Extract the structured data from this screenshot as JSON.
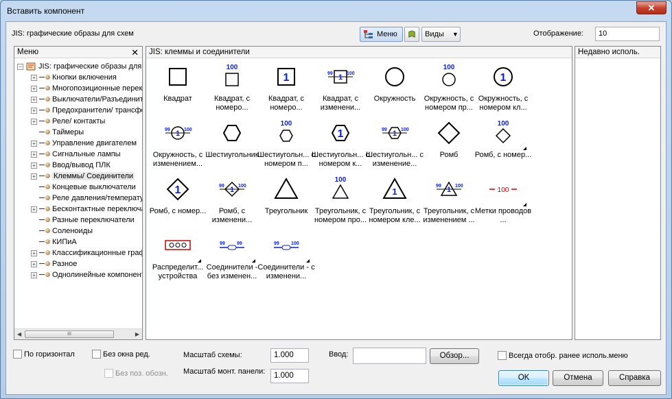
{
  "window": {
    "title": "Вставить компонент"
  },
  "header": {
    "label": "JIS: графические образы для схем",
    "menu_button": "Меню",
    "views_button": "Виды",
    "display_label": "Отображение:",
    "display_value": "10"
  },
  "left_pane": {
    "title": "Меню",
    "root": "JIS: графические образы для схем",
    "items": [
      {
        "label": "Кнопки включения",
        "expandable": true
      },
      {
        "label": "Многопозиционные переключатели",
        "expandable": true
      },
      {
        "label": "Выключатели/Разъединители",
        "expandable": true
      },
      {
        "label": "Предохранители/ трансформаторы",
        "expandable": true
      },
      {
        "label": "Реле/ контакты",
        "expandable": true
      },
      {
        "label": "Таймеры",
        "expandable": false
      },
      {
        "label": "Управление двигателем",
        "expandable": true
      },
      {
        "label": "Сигнальные лампы",
        "expandable": true
      },
      {
        "label": "Ввод/вывод ПЛК",
        "expandable": true
      },
      {
        "label": "Клеммы/ Соединители",
        "expandable": true,
        "selected": true
      },
      {
        "label": "Концевые выключатели",
        "expandable": false
      },
      {
        "label": "Реле давления/температуры",
        "expandable": false
      },
      {
        "label": "Бесконтактные переключатели",
        "expandable": true
      },
      {
        "label": "Разные переключатели",
        "expandable": false
      },
      {
        "label": "Соленоиды",
        "expandable": false
      },
      {
        "label": "КИПиА",
        "expandable": false
      },
      {
        "label": "Классификационные графические",
        "expandable": true
      },
      {
        "label": "Разное",
        "expandable": true
      },
      {
        "label": "Однолинейные компоненты",
        "expandable": true
      }
    ],
    "scroll_thumb": "III"
  },
  "mid_pane": {
    "title": "JIS: клеммы и соединители",
    "items": [
      {
        "label": "Квадрат",
        "icon": "square-icon"
      },
      {
        "label": "Квадрат, с номеро...",
        "icon": "square-number-icon",
        "num": "100"
      },
      {
        "label": "Квадрат, с номеро...",
        "icon": "square-inside-number-icon",
        "num": "1"
      },
      {
        "label": "Квадрат, с изменени...",
        "icon": "square-change-icon",
        "n1": "99",
        "n2": "1",
        "n3": "100"
      },
      {
        "label": "Окружность",
        "icon": "circle-icon"
      },
      {
        "label": "Окружность, с номером пр...",
        "icon": "circle-number-icon",
        "num": "100"
      },
      {
        "label": "Окружность, с номером кл...",
        "icon": "circle-inside-number-icon",
        "num": "1"
      },
      {
        "label": "Окружность, с изменением...",
        "icon": "circle-change-icon",
        "n1": "99",
        "n2": "1",
        "n3": "100"
      },
      {
        "label": "Шестиугольник",
        "icon": "hexagon-icon"
      },
      {
        "label": "Шестиугольн... с номером п...",
        "icon": "hexagon-number-icon",
        "num": "100"
      },
      {
        "label": "Шестиугольн... с номером к...",
        "icon": "hexagon-inside-number-icon",
        "num": "1"
      },
      {
        "label": "Шестиугольн... с изменение...",
        "icon": "hexagon-change-icon",
        "n1": "99",
        "n2": "1",
        "n3": "100"
      },
      {
        "label": "Ромб",
        "icon": "diamond-icon"
      },
      {
        "label": "Ромб, с номер...",
        "icon": "diamond-number-icon",
        "num": "100",
        "more": true
      },
      {
        "label": "Ромб, с номер...",
        "icon": "diamond-inside-number-icon",
        "num": "1"
      },
      {
        "label": "Ромб, с изменени...",
        "icon": "diamond-change-icon",
        "n1": "99",
        "n2": "1",
        "n3": "100"
      },
      {
        "label": "Треугольник",
        "icon": "triangle-icon"
      },
      {
        "label": "Треугольник, с номером про...",
        "icon": "triangle-number-icon",
        "num": "100"
      },
      {
        "label": "Треугольник, с номером кле...",
        "icon": "triangle-inside-number-icon",
        "num": "1"
      },
      {
        "label": "Треугольник, с изменением ...",
        "icon": "triangle-change-icon",
        "n1": "99",
        "n2": "1",
        "n3": "100"
      },
      {
        "label": "Метки проводов ...",
        "icon": "wire-label-icon",
        "num": "100",
        "more": true
      },
      {
        "label": "Распределит... устройства",
        "icon": "distributor-icon",
        "more": true
      },
      {
        "label": "Соединители - без изменен...",
        "icon": "connector-icon",
        "n1": "99",
        "n3": "99",
        "more": true
      },
      {
        "label": "Соединители - с изменени...",
        "icon": "connector-change-icon",
        "n1": "99",
        "n3": "100",
        "more": true
      }
    ]
  },
  "right_pane": {
    "title": "Недавно исполь."
  },
  "footer": {
    "horizontal_label": "По горизонтал",
    "no_edit_label": "Без окна ред.",
    "no_pos_label": "Без поз. обозн.",
    "scale_schema_label": "Масштаб схемы:",
    "scale_schema_value": "1.000",
    "scale_panel_label": "Масштаб монт. панели:",
    "scale_panel_value": "1.000",
    "input_label": "Ввод:",
    "input_value": "",
    "browse_button": "Обзор...",
    "always_show_label": "Всегда отобр. ранее исполь.меню",
    "ok_button": "OK",
    "cancel_button": "Отмена",
    "help_button": "Справка"
  }
}
